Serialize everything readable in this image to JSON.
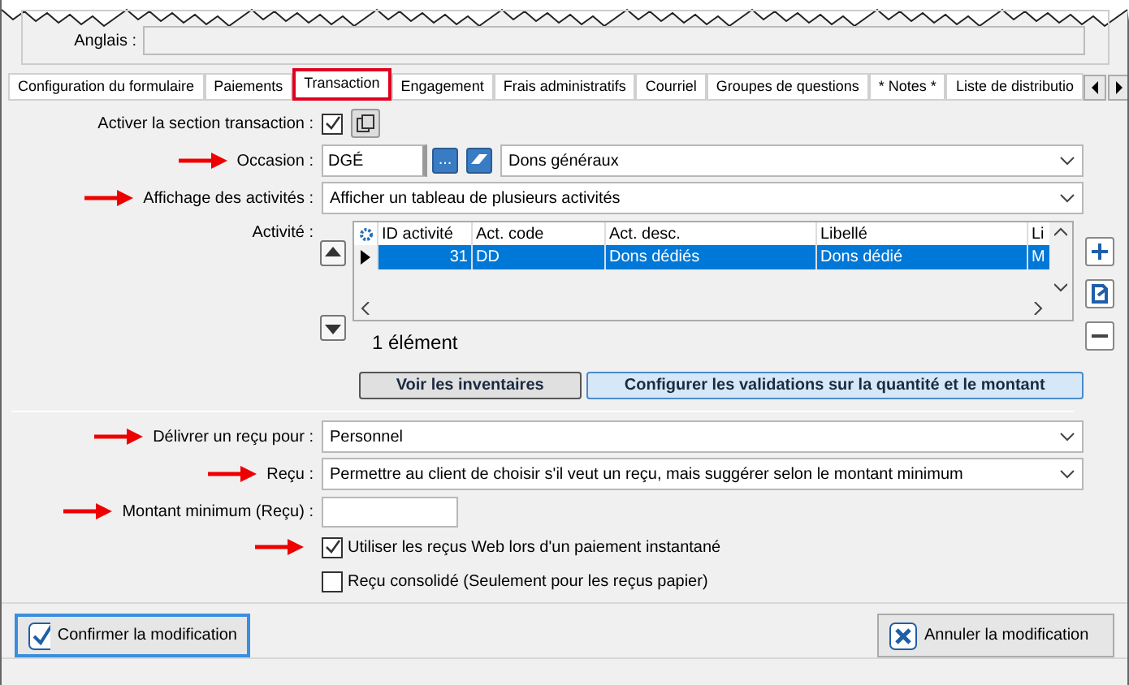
{
  "header": {
    "label": "Anglais :"
  },
  "tabs": [
    {
      "label": "Configuration du formulaire",
      "selected": false
    },
    {
      "label": "Paiements",
      "selected": false
    },
    {
      "label": "Transaction",
      "selected": true
    },
    {
      "label": "Engagement",
      "selected": false
    },
    {
      "label": "Frais administratifs",
      "selected": false
    },
    {
      "label": "Courriel",
      "selected": false
    },
    {
      "label": "Groupes de questions",
      "selected": false
    },
    {
      "label": "* Notes *",
      "selected": false
    },
    {
      "label": "Liste de distributio",
      "selected": false
    }
  ],
  "enable": {
    "label": "Activer la section transaction :",
    "checked": true
  },
  "occasion": {
    "label": "Occasion :",
    "annotated": true,
    "code": "DGÉ",
    "browse": "...",
    "value": "Dons généraux"
  },
  "display": {
    "label": "Affichage des activités :",
    "annotated": true,
    "value": "Afficher un tableau de plusieurs activités"
  },
  "activity": {
    "label": "Activité :",
    "columns": [
      "ID activité",
      "Act. code",
      "Act. desc.",
      "Libellé",
      "Li"
    ],
    "rows": [
      {
        "cells": [
          "31",
          "DD",
          "Dons dédiés",
          "Dons dédié",
          "M"
        ],
        "selected": true
      }
    ],
    "count": "1 élément"
  },
  "actions": [
    "Voir les inventaires",
    "Configurer les validations sur la quantité et le montant"
  ],
  "fields": [
    {
      "kind": "select",
      "label": "Délivrer un reçu pour :",
      "annotated": true,
      "value": "Personnel"
    },
    {
      "kind": "select",
      "label": "Reçu :",
      "annotated": true,
      "value": "Permettre au client de choisir s'il veut un reçu, mais suggérer selon le montant minimum"
    },
    {
      "kind": "input",
      "label": "Montant minimum (Reçu) :",
      "annotated": true
    },
    {
      "kind": "check",
      "label": "Utiliser les reçus Web lors d'un paiement instantané",
      "annotated": true,
      "checked": true
    },
    {
      "kind": "check",
      "label": "Reçu consolidé (Seulement pour les reçus papier)",
      "annotated": false,
      "checked": false
    }
  ],
  "footer": {
    "confirm": "Confirmer la modification",
    "cancel": "Annuler la modification"
  }
}
